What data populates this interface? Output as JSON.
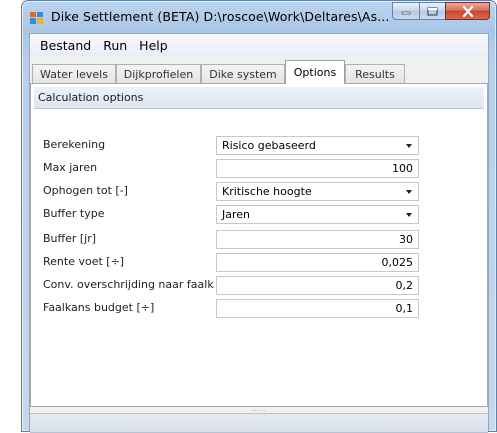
{
  "window": {
    "title": "Dike Settlement (BETA)  D:\\roscoe\\Work\\Deltares\\As...",
    "icon": "app-icon",
    "controls": [
      "minimize-icon",
      "maximize-icon",
      "close-icon"
    ]
  },
  "menu": {
    "items": [
      {
        "label": "Bestand"
      },
      {
        "label": "Run"
      },
      {
        "label": "Help"
      }
    ]
  },
  "tabs": [
    {
      "label": "Water levels",
      "active": false
    },
    {
      "label": "Dijkprofielen",
      "active": false
    },
    {
      "label": "Dike system",
      "active": false
    },
    {
      "label": "Options",
      "active": true
    },
    {
      "label": "Results",
      "active": false
    }
  ],
  "calculation_options": {
    "header": "Calculation options",
    "fields": [
      {
        "label": "Berekening",
        "type": "combo",
        "value": "Risico gebaseerd"
      },
      {
        "label": "Max jaren",
        "type": "number",
        "value": "100"
      },
      {
        "label": "Ophogen tot [-]",
        "type": "combo",
        "value": "Kritische hoogte"
      },
      {
        "label": "Buffer type",
        "type": "combo",
        "value": "Jaren"
      },
      {
        "label": "Buffer [jr]",
        "type": "number",
        "value": "30"
      },
      {
        "label": "Rente voet [÷]",
        "type": "number",
        "value": "0,025"
      },
      {
        "label": "Conv. overschrijding naar faalk",
        "type": "number",
        "value": "0,2"
      },
      {
        "label": "Faalkans budget [÷]",
        "type": "number",
        "value": "0,1"
      }
    ]
  },
  "splitter": {
    "grip": "......"
  },
  "colors": {
    "titlebar": "#a9c6e6",
    "close_button": "#c7452b",
    "header_band": "#dde6f1"
  }
}
